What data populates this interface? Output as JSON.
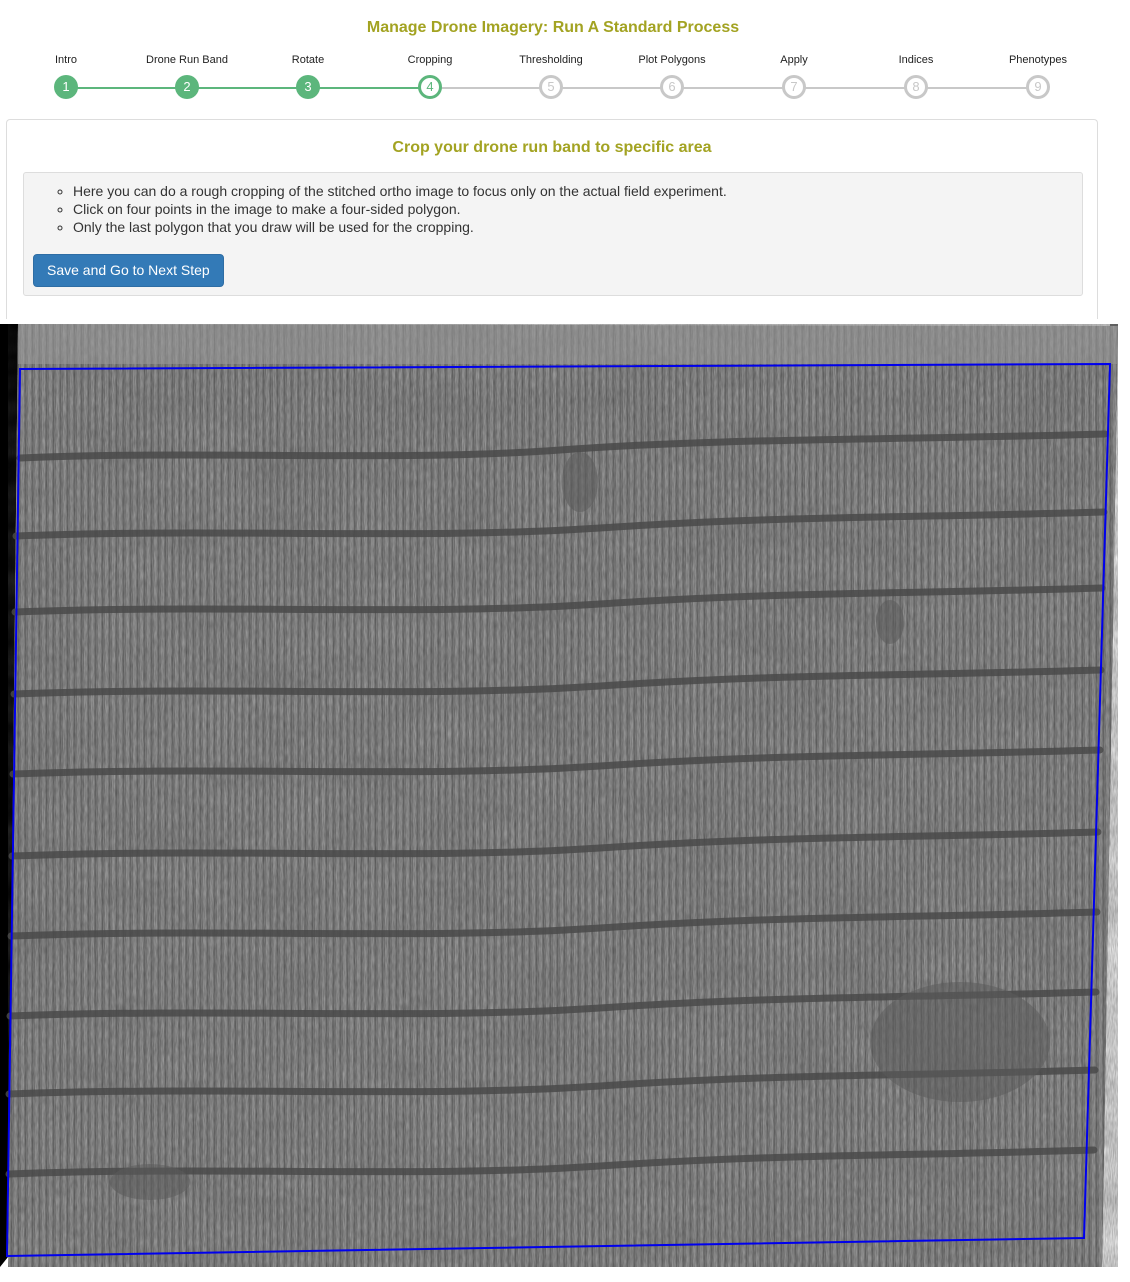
{
  "page": {
    "title": "Manage Drone Imagery: Run A Standard Process"
  },
  "stepper": {
    "current_step": 4,
    "steps": [
      {
        "label": "Intro",
        "number": "1",
        "state": "done"
      },
      {
        "label": "Drone Run Band",
        "number": "2",
        "state": "done"
      },
      {
        "label": "Rotate",
        "number": "3",
        "state": "done"
      },
      {
        "label": "Cropping",
        "number": "4",
        "state": "current"
      },
      {
        "label": "Thresholding",
        "number": "5",
        "state": "todo"
      },
      {
        "label": "Plot Polygons",
        "number": "6",
        "state": "todo"
      },
      {
        "label": "Apply",
        "number": "7",
        "state": "todo"
      },
      {
        "label": "Indices",
        "number": "8",
        "state": "todo"
      },
      {
        "label": "Phenotypes",
        "number": "9",
        "state": "todo"
      }
    ]
  },
  "crop_panel": {
    "title": "Crop your drone run band to specific area",
    "instructions": [
      "Here you can do a rough cropping of the stitched ortho image to focus only on the actual field experiment.",
      "Click on four points in the image to make a four-sided polygon.",
      "Only the last polygon that you draw will be used for the cropping."
    ],
    "save_button_label": "Save and Go to Next Step"
  },
  "image": {
    "description_icon": "drone-orthophoto-image",
    "polygon_color": "#0000ee"
  },
  "colors": {
    "title_accent": "#a3a322",
    "step_done": "#5cb67c",
    "step_todo": "#c8c8c8",
    "button_primary": "#337ab7"
  }
}
